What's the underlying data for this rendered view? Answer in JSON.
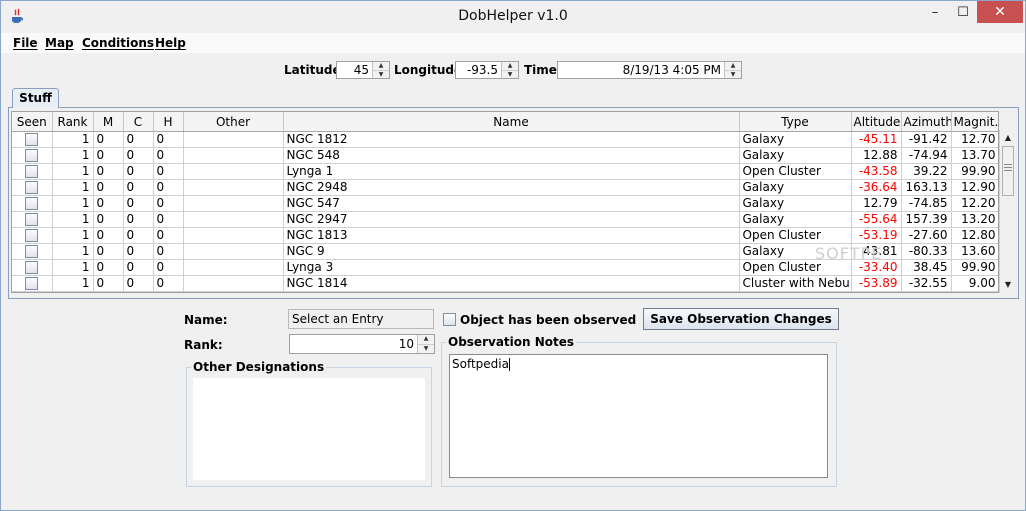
{
  "window": {
    "title": "DobHelper v1.0"
  },
  "window_controls": {
    "min": "–",
    "max": "☐",
    "close": "✕"
  },
  "menu": [
    "File",
    "Map",
    "Conditions",
    "Help"
  ],
  "toolbar": {
    "latitude_label": "Latitude",
    "latitude_value": "45",
    "longitude_label": "Longitude",
    "longitude_value": "-93.5",
    "time_label": "Time",
    "time_value": "8/19/13 4:05 PM"
  },
  "tab": {
    "label": "Stuff"
  },
  "table": {
    "columns": [
      "Seen",
      "Rank",
      "M",
      "C",
      "H",
      "Other",
      "Name",
      "Type",
      "Altitude",
      "Azimuth",
      "Magnit..."
    ],
    "rows": [
      {
        "rank": "1",
        "m": "0",
        "c": "0",
        "h": "0",
        "other": "",
        "name": "NGC 1812",
        "type": "Galaxy",
        "altitude": "-45.11",
        "azimuth": "-91.42",
        "magnitude": "12.70"
      },
      {
        "rank": "1",
        "m": "0",
        "c": "0",
        "h": "0",
        "other": "",
        "name": "NGC 548",
        "type": "Galaxy",
        "altitude": "12.88",
        "azimuth": "-74.94",
        "magnitude": "13.70"
      },
      {
        "rank": "1",
        "m": "0",
        "c": "0",
        "h": "0",
        "other": "",
        "name": "Lynga 1",
        "type": "Open Cluster",
        "altitude": "-43.58",
        "azimuth": "39.22",
        "magnitude": "99.90"
      },
      {
        "rank": "1",
        "m": "0",
        "c": "0",
        "h": "0",
        "other": "",
        "name": "NGC 2948",
        "type": "Galaxy",
        "altitude": "-36.64",
        "azimuth": "163.13",
        "magnitude": "12.90"
      },
      {
        "rank": "1",
        "m": "0",
        "c": "0",
        "h": "0",
        "other": "",
        "name": "NGC 547",
        "type": "Galaxy",
        "altitude": "12.79",
        "azimuth": "-74.85",
        "magnitude": "12.20"
      },
      {
        "rank": "1",
        "m": "0",
        "c": "0",
        "h": "0",
        "other": "",
        "name": "NGC 2947",
        "type": "Galaxy",
        "altitude": "-55.64",
        "azimuth": "157.39",
        "magnitude": "13.20"
      },
      {
        "rank": "1",
        "m": "0",
        "c": "0",
        "h": "0",
        "other": "",
        "name": "NGC 1813",
        "type": "Open Cluster",
        "altitude": "-53.19",
        "azimuth": "-27.60",
        "magnitude": "12.80"
      },
      {
        "rank": "1",
        "m": "0",
        "c": "0",
        "h": "0",
        "other": "",
        "name": "NGC 9",
        "type": "Galaxy",
        "altitude": "43.81",
        "azimuth": "-80.33",
        "magnitude": "13.60"
      },
      {
        "rank": "1",
        "m": "0",
        "c": "0",
        "h": "0",
        "other": "",
        "name": "Lynga 3",
        "type": "Open Cluster",
        "altitude": "-33.40",
        "azimuth": "38.45",
        "magnitude": "99.90"
      },
      {
        "rank": "1",
        "m": "0",
        "c": "0",
        "h": "0",
        "other": "",
        "name": "NGC 1814",
        "type": "Cluster with Nebu...",
        "altitude": "-53.89",
        "azimuth": "-32.55",
        "magnitude": "9.00"
      }
    ]
  },
  "detail": {
    "name_label": "Name:",
    "name_value": "Select an Entry",
    "observed_label": "Object has been observed",
    "save_button": "Save Observation Changes",
    "rank_label": "Rank:",
    "rank_value": "10",
    "other_designations_label": "Other Designations",
    "notes_label": "Observation Notes",
    "notes_value": "Softpedia"
  },
  "watermark": "SOFTPE",
  "colors": {
    "negative_altitude": "#ff0000",
    "close_button": "#c75050"
  }
}
